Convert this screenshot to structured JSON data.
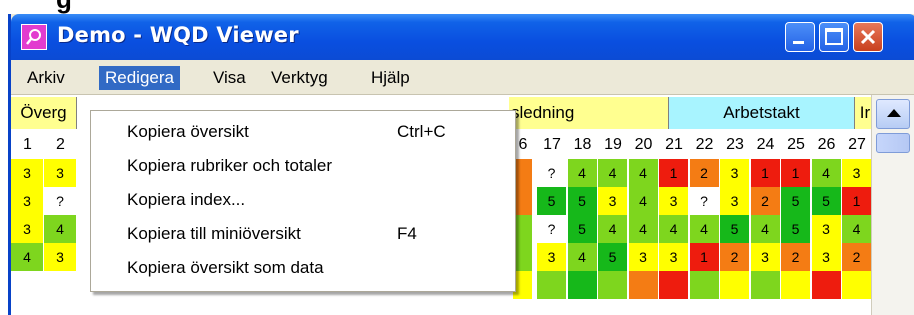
{
  "window": {
    "title": "Demo - WQD Viewer"
  },
  "menubar": {
    "items": [
      {
        "label": "Arkiv"
      },
      {
        "label": "Redigera"
      },
      {
        "label": "Visa"
      },
      {
        "label": "Verktyg"
      },
      {
        "label": "Hjälp"
      }
    ]
  },
  "dropdown": {
    "items": [
      {
        "label": "Kopiera översikt",
        "shortcut": "Ctrl+C"
      },
      {
        "label": "Kopiera rubriker och totaler",
        "shortcut": ""
      },
      {
        "label": "Kopiera index...",
        "shortcut": ""
      },
      {
        "label": "Kopiera till miniöversikt",
        "shortcut": "F4"
      },
      {
        "label": "Kopiera översikt som data",
        "shortcut": ""
      }
    ]
  },
  "grid": {
    "header_left": "Överg",
    "header_mid": "sledning",
    "header_right": "Arbetstakt",
    "header_far": "Ir",
    "left_nums": [
      "1",
      "2"
    ],
    "right_nums": [
      "6",
      "17",
      "18",
      "19",
      "20",
      "21",
      "22",
      "23",
      "24",
      "25",
      "26",
      "27"
    ],
    "rows_left": [
      [
        {
          "t": "3",
          "c": "yellow"
        },
        {
          "t": "3",
          "c": "yellow"
        }
      ],
      [
        {
          "t": "3",
          "c": "yellow"
        },
        {
          "t": "?",
          "c": "white"
        }
      ],
      [
        {
          "t": "3",
          "c": "yellow"
        },
        {
          "t": "4",
          "c": "lightgreen"
        }
      ],
      [
        {
          "t": "4",
          "c": "lightgreen"
        },
        {
          "t": "3",
          "c": "yellow"
        }
      ]
    ],
    "rows_right": [
      [
        {
          "t": "",
          "c": "orange"
        },
        {
          "t": "?",
          "c": "white"
        },
        {
          "t": "4",
          "c": "lightgreen"
        },
        {
          "t": "4",
          "c": "lightgreen"
        },
        {
          "t": "4",
          "c": "lightgreen"
        },
        {
          "t": "1",
          "c": "red"
        },
        {
          "t": "2",
          "c": "orange"
        },
        {
          "t": "3",
          "c": "yellow"
        },
        {
          "t": "1",
          "c": "red"
        },
        {
          "t": "1",
          "c": "red"
        },
        {
          "t": "4",
          "c": "lightgreen"
        },
        {
          "t": "3",
          "c": "yellow"
        }
      ],
      [
        {
          "t": "",
          "c": "orange"
        },
        {
          "t": "5",
          "c": "green"
        },
        {
          "t": "5",
          "c": "green"
        },
        {
          "t": "3",
          "c": "yellow"
        },
        {
          "t": "4",
          "c": "lightgreen"
        },
        {
          "t": "3",
          "c": "yellow"
        },
        {
          "t": "?",
          "c": "white"
        },
        {
          "t": "3",
          "c": "yellow"
        },
        {
          "t": "2",
          "c": "orange"
        },
        {
          "t": "5",
          "c": "green"
        },
        {
          "t": "5",
          "c": "green"
        },
        {
          "t": "1",
          "c": "red"
        }
      ],
      [
        {
          "t": "",
          "c": "lightgreen"
        },
        {
          "t": "?",
          "c": "white"
        },
        {
          "t": "5",
          "c": "green"
        },
        {
          "t": "4",
          "c": "lightgreen"
        },
        {
          "t": "4",
          "c": "lightgreen"
        },
        {
          "t": "4",
          "c": "lightgreen"
        },
        {
          "t": "4",
          "c": "lightgreen"
        },
        {
          "t": "5",
          "c": "green"
        },
        {
          "t": "4",
          "c": "lightgreen"
        },
        {
          "t": "5",
          "c": "green"
        },
        {
          "t": "3",
          "c": "yellow"
        },
        {
          "t": "4",
          "c": "lightgreen"
        }
      ],
      [
        {
          "t": "",
          "c": "lightgreen"
        },
        {
          "t": "3",
          "c": "yellow"
        },
        {
          "t": "4",
          "c": "lightgreen"
        },
        {
          "t": "5",
          "c": "green"
        },
        {
          "t": "3",
          "c": "yellow"
        },
        {
          "t": "3",
          "c": "yellow"
        },
        {
          "t": "1",
          "c": "red"
        },
        {
          "t": "2",
          "c": "orange"
        },
        {
          "t": "3",
          "c": "yellow"
        },
        {
          "t": "2",
          "c": "orange"
        },
        {
          "t": "3",
          "c": "yellow"
        },
        {
          "t": "2",
          "c": "orange"
        }
      ]
    ]
  },
  "colors": {
    "red": "#ee1c0e",
    "orange": "#f47c14",
    "yellow": "#ffff00",
    "lightgreen": "#7ed61e",
    "green": "#16b81a",
    "white": "#ffffff",
    "header_yellow": "#ffff90",
    "header_cyan": "#a8f4ff"
  },
  "icons": {
    "app": "magnifier-icon",
    "minimize": "minimize-icon",
    "maximize": "maximize-icon",
    "close": "close-icon"
  }
}
